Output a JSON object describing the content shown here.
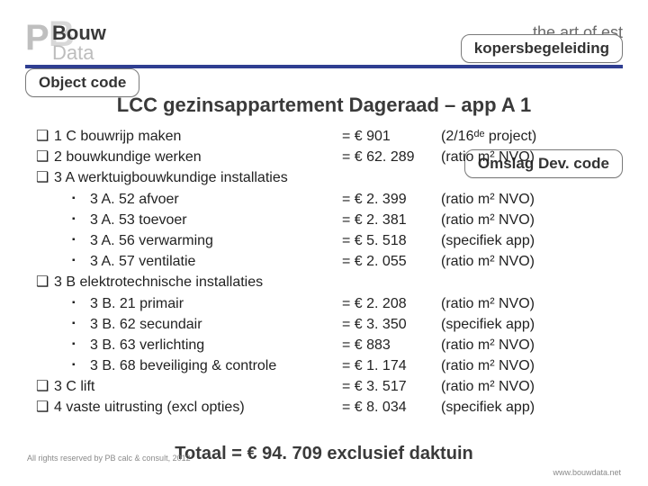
{
  "logo": {
    "top": "Bouw",
    "bottom": "Data"
  },
  "tagline_prefix": "the art of est",
  "callouts": {
    "object_code": "Object code",
    "kopers": "kopersbegeleiding",
    "omslag": "Omslag Dev. code"
  },
  "title": "LCC gezinsappartement Dageraad – app A 1",
  "items": [
    {
      "lvl": 1,
      "label": "1 C bouwrijp maken",
      "val": "= € 901",
      "note": "(2/16ᵈᵉ project)"
    },
    {
      "lvl": 1,
      "label": "2 bouwkundige werken",
      "val": "= € 62. 289",
      "note": "(ratio m² NVO)"
    },
    {
      "lvl": 1,
      "label": "3 A werktuigbouwkundige installaties",
      "val": "",
      "note": ""
    },
    {
      "lvl": 2,
      "label": "3 A. 52 afvoer",
      "val": "= € 2. 399",
      "note": "(ratio m² NVO)"
    },
    {
      "lvl": 2,
      "label": "3 A. 53 toevoer",
      "val": "= € 2. 381",
      "note": "(ratio m² NVO)"
    },
    {
      "lvl": 2,
      "label": "3 A. 56 verwarming",
      "val": "= € 5. 518",
      "note": "(specifiek app)"
    },
    {
      "lvl": 2,
      "label": "3 A. 57 ventilatie",
      "val": "= € 2. 055",
      "note": "(ratio m² NVO)"
    },
    {
      "lvl": 1,
      "label": "3 B elektrotechnische installaties",
      "val": "",
      "note": ""
    },
    {
      "lvl": 2,
      "label": "3 B. 21 primair",
      "val": "= € 2. 208",
      "note": "(ratio m² NVO)"
    },
    {
      "lvl": 2,
      "label": "3 B. 62 secundair",
      "val": "= € 3. 350",
      "note": "(specifiek app)"
    },
    {
      "lvl": 2,
      "label": "3 B. 63 verlichting",
      "val": "= € 883",
      "note": "(ratio m² NVO)"
    },
    {
      "lvl": 2,
      "label": "3 B. 68 beveiliging & controle",
      "val": "= € 1. 174",
      "note": "(ratio m² NVO)"
    },
    {
      "lvl": 1,
      "label": "3 C lift",
      "val": "= € 3. 517",
      "note": "(ratio m² NVO)"
    },
    {
      "lvl": 1,
      "label": "4 vaste uitrusting (excl opties)",
      "val": "= € 8. 034",
      "note": "(specifiek app)"
    }
  ],
  "total": "Totaal = € 94. 709 exclusief daktuin",
  "copyright": "All rights reserved by PB calc & consult, 2012",
  "website": "www.bouwdata.net"
}
